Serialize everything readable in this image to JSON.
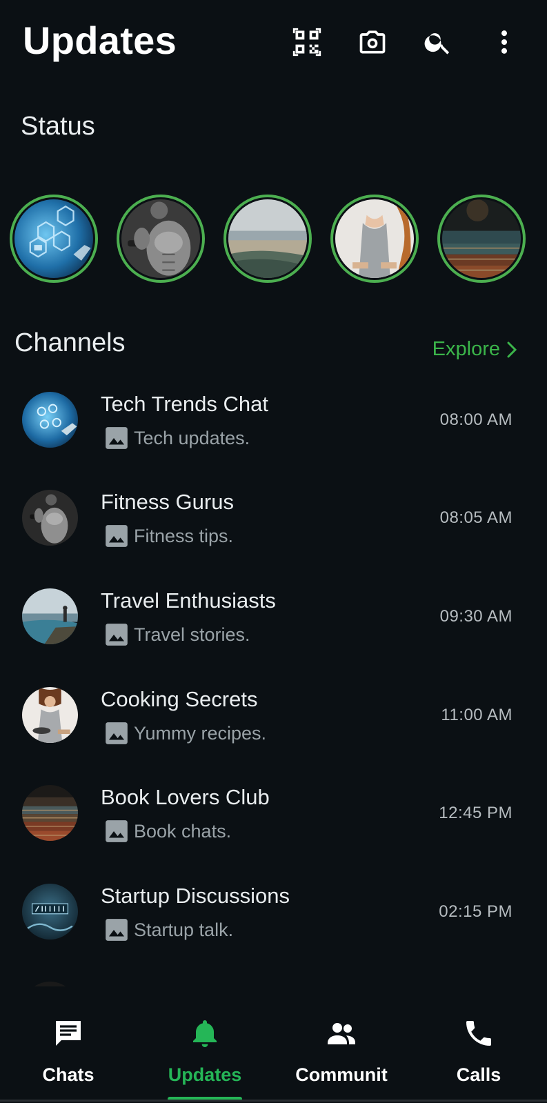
{
  "header": {
    "title": "Updates",
    "icons": [
      "qr-code-icon",
      "camera-icon",
      "search-icon",
      "more-vert-icon"
    ]
  },
  "status": {
    "title": "Status",
    "ring_color": "#4caf50",
    "items": [
      {
        "image": "tech-network-thumbnail"
      },
      {
        "image": "fitness-athlete-thumbnail"
      },
      {
        "image": "landscape-view-thumbnail"
      },
      {
        "image": "cooking-woman-thumbnail"
      },
      {
        "image": "old-books-thumbnail"
      }
    ]
  },
  "channels": {
    "title": "Channels",
    "explore_label": "Explore",
    "accent": "#3bb54a",
    "items": [
      {
        "name": "Tech Trends Chat",
        "preview": "Tech updates.",
        "time": "08:00 AM"
      },
      {
        "name": "Fitness Gurus",
        "preview": "Fitness tips.",
        "time": "08:05 AM"
      },
      {
        "name": "Travel Enthusiasts",
        "preview": "Travel stories.",
        "time": "09:30 AM"
      },
      {
        "name": "Cooking Secrets",
        "preview": "Yummy recipes.",
        "time": "11:00 AM"
      },
      {
        "name": "Book Lovers Club",
        "preview": "Book chats.",
        "time": "12:45 PM"
      },
      {
        "name": "Startup Discussions",
        "preview": "Startup talk.",
        "time": "02:15 PM"
      }
    ]
  },
  "bottom_nav": {
    "active": "Updates",
    "active_color": "#25b657",
    "items": [
      {
        "label": "Chats",
        "icon": "chat-icon"
      },
      {
        "label": "Updates",
        "icon": "bell-icon"
      },
      {
        "label": "Communit",
        "icon": "people-icon"
      },
      {
        "label": "Calls",
        "icon": "phone-icon"
      }
    ]
  }
}
